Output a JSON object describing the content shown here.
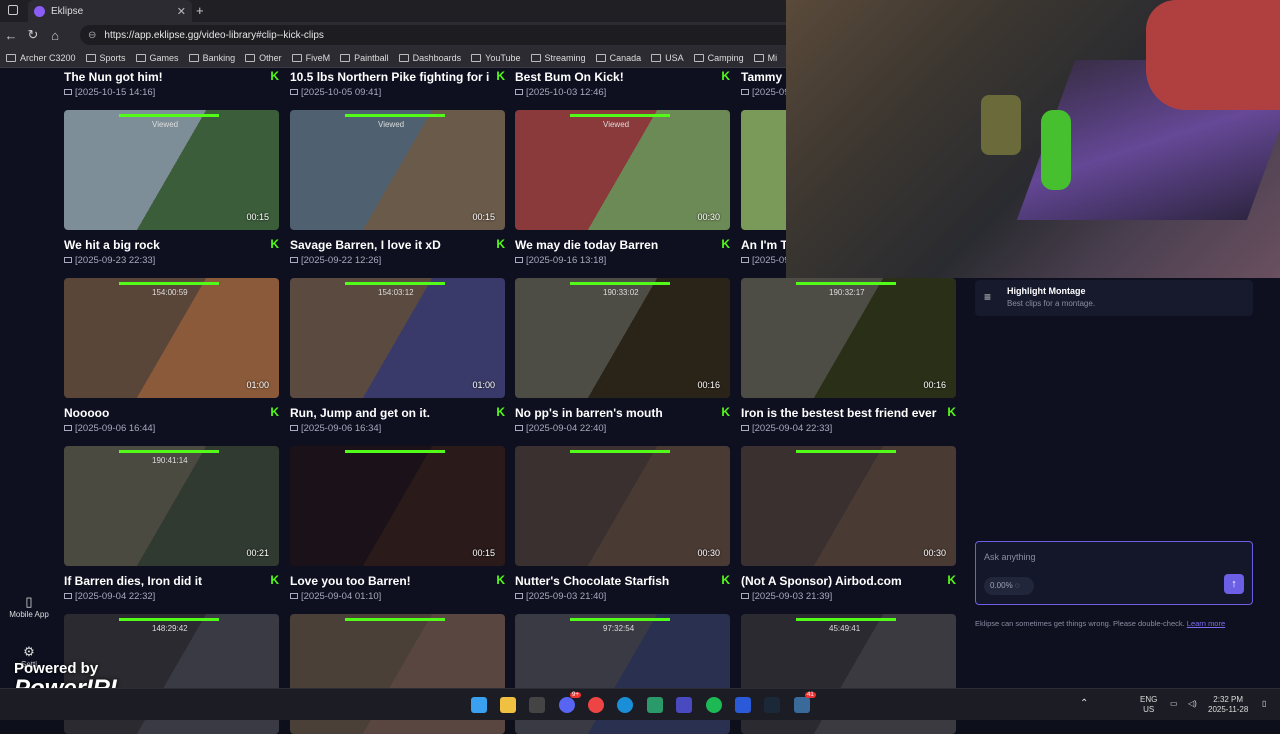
{
  "browser": {
    "tab_title": "Eklipse",
    "url": "https://app.eklipse.gg/video-library#clip--kick-clips",
    "bookmarks": [
      "Archer C3200",
      "Sports",
      "Games",
      "Banking",
      "Other",
      "FiveM",
      "Paintball",
      "Dashboards",
      "YouTube",
      "Streaming",
      "Canada",
      "USA",
      "Camping",
      "Mi"
    ]
  },
  "sidebar": {
    "mobile_app_label": "Mobile App",
    "settings_label": "Setti"
  },
  "top_row": [
    {
      "title": "The Nun got him!",
      "date": "[2025-10-15 14:16]"
    },
    {
      "title": "10.5 lbs Northern Pike fighting for i...",
      "date": "[2025-10-05 09:41]"
    },
    {
      "title": "Best Bum On Kick!",
      "date": "[2025-10-03 12:46]"
    },
    {
      "title": "Tammy g",
      "date": "[2025-09"
    }
  ],
  "clips": [
    {
      "title": "We hit a big rock",
      "date": "[2025-09-23 22:33]",
      "duration": "00:15",
      "overlay": "Viewed",
      "color_a": "#7e8e98",
      "color_b": "#3b5d3a"
    },
    {
      "title": "Savage Barren, I love it xD",
      "date": "[2025-09-22 12:26]",
      "duration": "00:15",
      "overlay": "Viewed",
      "color_a": "#4f6170",
      "color_b": "#6a5a4a"
    },
    {
      "title": "We may die today Barren",
      "date": "[2025-09-16 13:18]",
      "duration": "00:30",
      "overlay": "Viewed",
      "color_a": "#8a3a3a",
      "color_b": "#6c8a55"
    },
    {
      "title": "An I'm Th",
      "date": "[2025-09",
      "duration": "",
      "overlay": "",
      "color_a": "#7a9a5a",
      "color_b": "#a0b070"
    },
    {
      "title": "Nooooo",
      "date": "[2025-09-06 16:44]",
      "duration": "01:00",
      "overlay": "154:00:59",
      "color_a": "#5a4638",
      "color_b": "#8a5a3a"
    },
    {
      "title": "Run, Jump and get on it.",
      "date": "[2025-09-06 16:34]",
      "duration": "01:00",
      "overlay": "154:03:12",
      "color_a": "#5a4a40",
      "color_b": "#3a3a6a"
    },
    {
      "title": "No pp's in barren's mouth",
      "date": "[2025-09-04 22:40]",
      "duration": "00:16",
      "overlay": "190:33:02",
      "color_a": "#4e4d45",
      "color_b": "#2a2418"
    },
    {
      "title": "Iron is the bestest best friend ever",
      "date": "[2025-09-04 22:33]",
      "duration": "00:16",
      "overlay": "190:32:17",
      "color_a": "#4e4d45",
      "color_b": "#2a3018"
    },
    {
      "title": "If Barren dies, Iron did it",
      "date": "[2025-09-04 22:32]",
      "duration": "00:21",
      "overlay": "190:41:14",
      "color_a": "#4a4a40",
      "color_b": "#303a30"
    },
    {
      "title": "Love you too Barren!",
      "date": "[2025-09-04 01:10]",
      "duration": "00:15",
      "overlay": "",
      "color_a": "#1a1218",
      "color_b": "#2a1a1a"
    },
    {
      "title": "Nutter's Chocolate Starfish",
      "date": "[2025-09-03 21:40]",
      "duration": "00:30",
      "overlay": "",
      "color_a": "#3a3030",
      "color_b": "#4a3a34"
    },
    {
      "title": "(Not A Sponsor) Airbod.com",
      "date": "[2025-09-03 21:39]",
      "duration": "00:30",
      "overlay": "",
      "color_a": "#3a3030",
      "color_b": "#4a3a34"
    },
    {
      "title": "",
      "date": "",
      "duration": "",
      "overlay": "148:29:42",
      "color_a": "#2a2a30",
      "color_b": "#3a3a44"
    },
    {
      "title": "",
      "date": "",
      "duration": "",
      "overlay": "",
      "color_a": "#4a4038",
      "color_b": "#5a4640"
    },
    {
      "title": "",
      "date": "",
      "duration": "",
      "overlay": "97:32:54",
      "color_a": "#3a3a44",
      "color_b": "#2a3050"
    },
    {
      "title": "",
      "date": "",
      "duration": "",
      "overlay": "45:49:41",
      "color_a": "#2a2a30",
      "color_b": "#3a3a40"
    }
  ],
  "kick_badge": "K",
  "right_panel": {
    "montage_title": "Highlight Montage",
    "montage_subtitle": "Best clips for a montage.",
    "ask_placeholder": "Ask anything",
    "percent": "0.00%",
    "disclaimer": "Eklipse can sometimes get things wrong. Please double-check.",
    "learn_more": "Learn more"
  },
  "branding": {
    "line1": "Powered by",
    "line2": "PowerIRL"
  },
  "taskbar": {
    "lang": "ENG",
    "region": "US",
    "time": "2:32 PM",
    "date": "2025-11-28",
    "discord_badge": "9+",
    "app_badge": "41"
  },
  "colors": {
    "kick_green": "#53fc18",
    "accent": "#6d5ee6",
    "bg": "#0e1020"
  }
}
